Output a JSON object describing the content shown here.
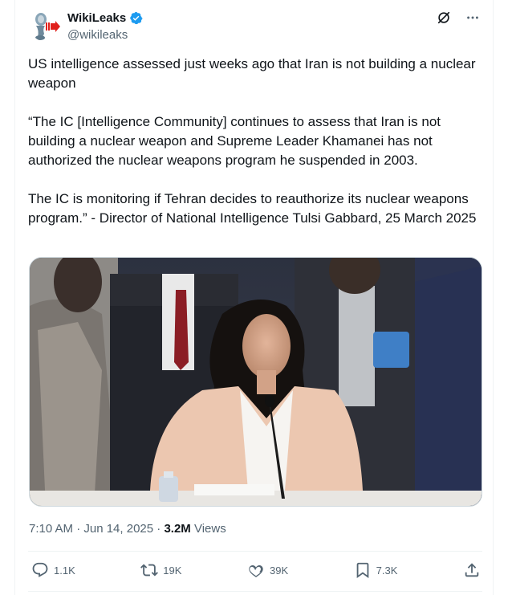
{
  "author": {
    "display_name": "WikiLeaks",
    "handle": "@wikileaks"
  },
  "tweet": {
    "paragraphs": [
      "US intelligence assessed just weeks ago that Iran is not building a nuclear weapon",
      "“The IC [Intelligence Community] continues to assess that Iran is not building a nuclear weapon and Supreme Leader Khamanei has not authorized the nuclear weapons program he suspended in 2003.",
      "The IC is monitoring if Tehran decides to reauthorize its nuclear weapons program.” - Director of National Intelligence Tulsi Gabbard, 25 March 2025"
    ]
  },
  "meta": {
    "timestamp": "7:10 AM · Jun 14, 2025 · ",
    "views_count": "3.2M",
    "views_label": " Views"
  },
  "actions": {
    "replies": "1.1K",
    "reposts": "19K",
    "likes": "39K",
    "bookmarks": "7.3K"
  },
  "icons": {
    "verified": "verified-badge-icon",
    "grok": "grok-icon",
    "more": "more-icon",
    "reply": "reply-icon",
    "repost": "repost-icon",
    "like": "like-icon",
    "bookmark": "bookmark-icon",
    "share": "share-icon"
  },
  "colors": {
    "verified_blue": "#1d9bf0",
    "secondary_text": "#536471",
    "primary_text": "#0f1419"
  }
}
